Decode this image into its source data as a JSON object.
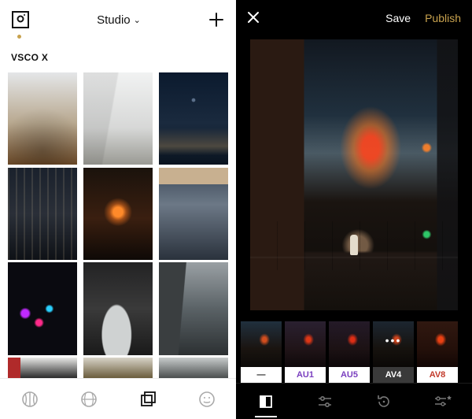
{
  "left": {
    "header": {
      "title": "Studio"
    },
    "section_label": "VSCO X",
    "nav_active_index": 2
  },
  "right": {
    "header": {
      "save_label": "Save",
      "publish_label": "Publish"
    },
    "presets": [
      {
        "label": "—",
        "selected": false,
        "color": "none"
      },
      {
        "label": "AU1",
        "selected": false,
        "color": "purple"
      },
      {
        "label": "AU5",
        "selected": false,
        "color": "purple"
      },
      {
        "label": "AV4",
        "selected": true,
        "color": "none"
      },
      {
        "label": "AV8",
        "selected": false,
        "color": "red"
      }
    ],
    "footer_active_index": 0
  },
  "colors": {
    "accent_gold": "#c8a24e",
    "preset_purple": "#7a3fbf",
    "preset_red": "#c23a2a"
  }
}
